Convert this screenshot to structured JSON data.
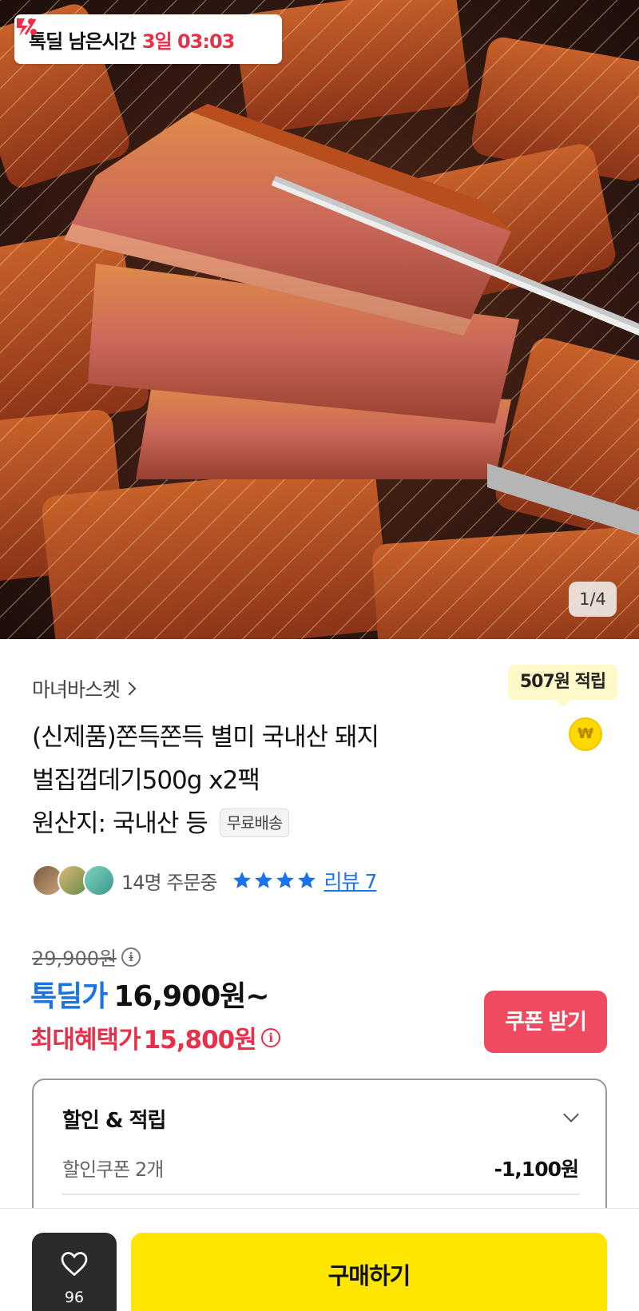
{
  "deal_timer": {
    "label": "톡딜 남은시간",
    "value": "3일 03:03",
    "icon": "tokdeal-logo-icon"
  },
  "gallery": {
    "pager": "1/4"
  },
  "product": {
    "brand": "마녀바스켓",
    "title_line1": "(신제품)쫀득쫀득 별미 국내산 돼지",
    "title_line2": "벌집껍데기500g x2팩",
    "title_line3": "원산지: 국내산 등",
    "free_shipping": "무료배송",
    "reward_bubble": "507원 적립",
    "reward_coin": "₩"
  },
  "social": {
    "orders": "14명 주문중",
    "rating": 4,
    "review_link": "리뷰 7"
  },
  "price": {
    "original": "29,900원",
    "deal_label": "톡딜가",
    "deal_value": "16,900원~",
    "max_label": "최대혜택가",
    "max_value": "15,800원",
    "coupon_button": "쿠폰 받기"
  },
  "discount": {
    "heading": "할인 & 적립",
    "row_label": "할인쿠폰 2개",
    "row_value": "-1,100원"
  },
  "bottom_bar": {
    "like_count": "96",
    "buy_button": "구매하기"
  },
  "colors": {
    "accent_blue": "#1a73e8",
    "accent_red": "#e8304a",
    "buy_yellow": "#ffe600",
    "coupon_red": "#ef4a5f"
  }
}
